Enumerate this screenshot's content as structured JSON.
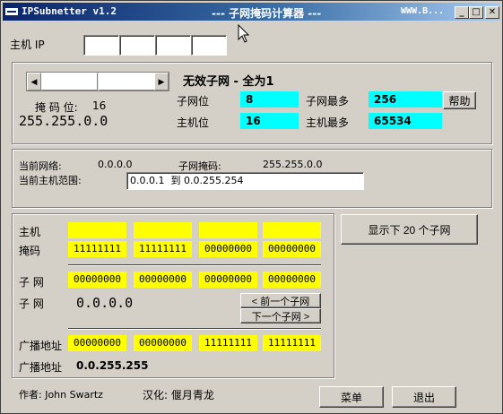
{
  "title": {
    "app": "IPSubnetter v1.2",
    "center": "--- 子网掩码计算器 ---",
    "right": "WWW.B..."
  },
  "window_controls": {
    "minimize": "_",
    "maximize": "□",
    "close": "✕"
  },
  "host_ip": {
    "label": "主机 IP",
    "octets": [
      "",
      "",
      "",
      ""
    ]
  },
  "mask": {
    "bits_label": "掩 码 位:",
    "bits_value": "16",
    "mask_value": "255.255.0.0",
    "slider_left": "◀",
    "slider_right": "▶"
  },
  "subnet_info": {
    "invalid_note": "无效子网 - 全为1",
    "subnet_bits_label": "子网位",
    "subnet_bits_value": "8",
    "max_subnets_label": "子网最多",
    "max_subnets_value": "256",
    "host_bits_label": "主机位",
    "host_bits_value": "16",
    "max_hosts_label": "主机最多",
    "max_hosts_value": "65534",
    "help_button": "帮助"
  },
  "current": {
    "network_label": "当前网络:",
    "network_value": "0.0.0.0",
    "subnet_mask_label": "子网掩码:",
    "subnet_mask_value": "255.255.0.0",
    "host_range_label": "当前主机范围:",
    "host_range_value": "0.0.0.1  到 0.0.255.254"
  },
  "binary": {
    "host_label": "主机",
    "mask_label": "掩码",
    "mask_bits": [
      "11111111",
      "11111111",
      "00000000",
      "00000000"
    ],
    "subnet_label": "子 网",
    "subnet_bits": [
      "00000000",
      "00000000",
      "00000000",
      "00000000"
    ],
    "subnet_label2": "子 网",
    "subnet_value": "0.0.0.0",
    "prev_button": "< 前一个子网",
    "next_button": "下一个子网 >",
    "broadcast_label": "广播地址",
    "broadcast_bits": [
      "00000000",
      "00000000",
      "11111111",
      "11111111"
    ],
    "broadcast_label2": "广播地址",
    "broadcast_value": "0.0.255.255"
  },
  "show_next_button": "显示下 20 个子网",
  "footer": {
    "author": "作者: John Swartz",
    "localized": "汉化: 偃月青龙",
    "menu_button": "菜单",
    "exit_button": "退出"
  },
  "colors": {
    "cyan": "#00ffff",
    "yellow": "#ffff00",
    "face": "#d4d0c8",
    "title_start": "#0a246a",
    "title_end": "#a6caf0"
  }
}
